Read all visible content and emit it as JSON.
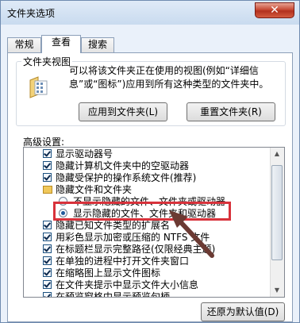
{
  "window": {
    "title": "文件夹选项",
    "close_symbol": "✕"
  },
  "tabs": [
    {
      "label": "常规",
      "active": false
    },
    {
      "label": "查看",
      "active": true
    },
    {
      "label": "搜索",
      "active": false
    }
  ],
  "folder_views": {
    "group_label": "文件夹视图",
    "description": "可以将该文件夹正在使用的视图(例如“详细信息”或“图标”)应用到所有这种类型的文件夹中。",
    "apply_button": "应用到文件夹(L)",
    "reset_button": "重置文件夹(R)",
    "icon": "folder-icon"
  },
  "advanced": {
    "label": "高级设置:",
    "items": [
      {
        "type": "checkbox",
        "label": "显示驱动器号",
        "checked": true
      },
      {
        "type": "checkbox",
        "label": "隐藏计算机文件夹中的空驱动器",
        "checked": true
      },
      {
        "type": "checkbox",
        "label": "隐藏受保护的操作系统文件(推荐)",
        "checked": true
      },
      {
        "type": "folder",
        "label": "隐藏文件和文件夹"
      },
      {
        "type": "radio",
        "label": "不显示隐藏的文件、文件夹或驱动器",
        "selected": false
      },
      {
        "type": "radio",
        "label": "显示隐藏的文件、文件夹和驱动器",
        "selected": true
      },
      {
        "type": "checkbox",
        "label": "隐藏已知文件类型的扩展名",
        "checked": true
      },
      {
        "type": "checkbox",
        "label": "用彩色显示加密或压缩的 NTFS 文件",
        "checked": true
      },
      {
        "type": "checkbox",
        "label": "在标题栏显示完整路径(仅限经典主题)",
        "checked": true
      },
      {
        "type": "checkbox",
        "label": "在单独的进程中打开文件夹窗口",
        "checked": true
      },
      {
        "type": "checkbox",
        "label": "在缩略图上显示文件图标",
        "checked": true
      },
      {
        "type": "checkbox",
        "label": "在文件夹提示中显示文件大小信息",
        "checked": true
      },
      {
        "type": "checkbox",
        "label": "在预览窗格中显示预览句柄",
        "checked": true
      }
    ],
    "restore_button": "还原为默认值(D)"
  },
  "colors": {
    "highlight_box": "#d8323b",
    "arrow": "#6b3a33"
  }
}
